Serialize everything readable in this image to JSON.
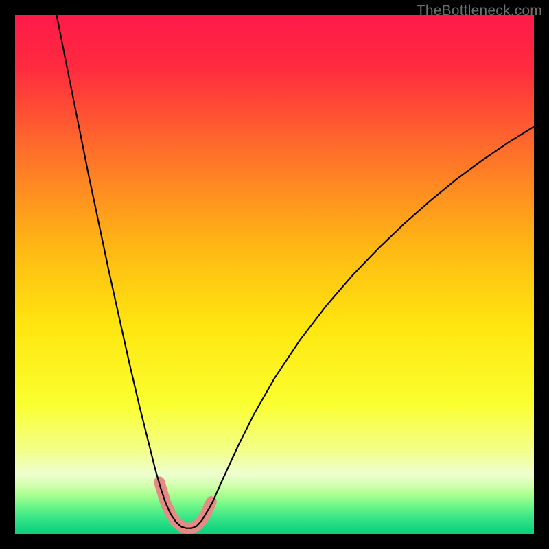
{
  "attribution": "TheBottleneck.com",
  "chart_data": {
    "type": "line",
    "title": "",
    "xlabel": "",
    "ylabel": "",
    "xlim": [
      0,
      100
    ],
    "ylim": [
      0,
      100
    ],
    "background_gradient": {
      "stops": [
        {
          "offset": 0.0,
          "color": "#ff1a49"
        },
        {
          "offset": 0.1,
          "color": "#ff2a3f"
        },
        {
          "offset": 0.25,
          "color": "#ff6a2c"
        },
        {
          "offset": 0.45,
          "color": "#ffb914"
        },
        {
          "offset": 0.6,
          "color": "#ffe60f"
        },
        {
          "offset": 0.75,
          "color": "#faff30"
        },
        {
          "offset": 0.84,
          "color": "#f3ff8a"
        },
        {
          "offset": 0.885,
          "color": "#eeffd0"
        },
        {
          "offset": 0.905,
          "color": "#d4ffb0"
        },
        {
          "offset": 0.925,
          "color": "#a8ff90"
        },
        {
          "offset": 0.945,
          "color": "#70f789"
        },
        {
          "offset": 0.965,
          "color": "#40e888"
        },
        {
          "offset": 0.985,
          "color": "#1ed981"
        },
        {
          "offset": 1.0,
          "color": "#0fce7b"
        }
      ]
    },
    "series": [
      {
        "name": "bottleneck-curve",
        "color": "#000000",
        "stroke_width": 2.2,
        "x": [
          8.0,
          10.0,
          12.0,
          14.0,
          16.0,
          18.0,
          20.0,
          22.0,
          24.0,
          25.0,
          26.0,
          27.0,
          28.0,
          29.0,
          30.0,
          31.0,
          32.0,
          33.0,
          34.0,
          35.0,
          36.0,
          38.0,
          40.0,
          43.0,
          46.0,
          50.0,
          55.0,
          60.0,
          65.0,
          70.0,
          75.0,
          80.0,
          85.0,
          90.0,
          95.0,
          100.0
        ],
        "y": [
          100.0,
          90.0,
          80.0,
          70.0,
          60.5,
          51.0,
          42.0,
          33.0,
          24.5,
          20.5,
          16.5,
          12.5,
          9.0,
          6.0,
          3.8,
          2.3,
          1.4,
          1.1,
          1.1,
          1.5,
          2.6,
          6.0,
          10.5,
          17.0,
          23.0,
          30.0,
          37.5,
          44.0,
          49.8,
          55.0,
          59.8,
          64.2,
          68.3,
          72.0,
          75.4,
          78.5
        ]
      },
      {
        "name": "highlight-band",
        "color": "#e68a84",
        "stroke_width": 16,
        "linecap": "round",
        "x": [
          27.8,
          29.0,
          30.0,
          31.0,
          32.0,
          33.0,
          34.0,
          35.0,
          36.0,
          37.0,
          37.8
        ],
        "y": [
          10.0,
          6.0,
          3.8,
          2.3,
          1.4,
          1.1,
          1.1,
          1.5,
          2.6,
          4.4,
          6.2
        ]
      }
    ]
  }
}
